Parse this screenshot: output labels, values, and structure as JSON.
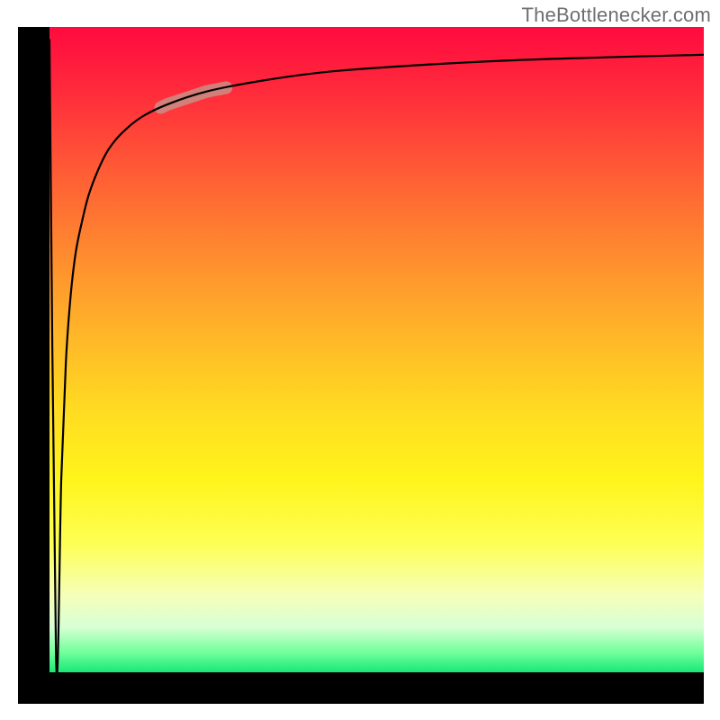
{
  "watermark": "TheBottlenecker.com",
  "chart_data": {
    "type": "line",
    "title": "",
    "xlabel": "",
    "ylabel": "",
    "xlim": [
      0,
      100
    ],
    "ylim": [
      0,
      100
    ],
    "grid": false,
    "background_gradient": {
      "direction": "vertical",
      "stops": [
        {
          "pos": 0.0,
          "color": "#ff0a3f"
        },
        {
          "pos": 0.35,
          "color": "#ff8a2f"
        },
        {
          "pos": 0.6,
          "color": "#ffdd21"
        },
        {
          "pos": 0.88,
          "color": "#f5ffb8"
        },
        {
          "pos": 1.0,
          "color": "#18e877"
        }
      ]
    },
    "series": [
      {
        "name": "bottleneck-curve",
        "type": "line",
        "color": "#000000",
        "x": [
          0,
          1.0,
          1.8,
          2.5,
          3.2,
          4.0,
          5.0,
          6.0,
          7.5,
          9.0,
          11,
          14,
          18,
          24,
          32,
          42,
          55,
          70,
          85,
          100
        ],
        "y": [
          98,
          2,
          30,
          48,
          58,
          65,
          70,
          74,
          78,
          81,
          83.5,
          86,
          88,
          90,
          91.6,
          93,
          94,
          94.8,
          95.3,
          95.7
        ]
      }
    ],
    "annotations": [
      {
        "type": "highlight-segment",
        "series": "bottleneck-curve",
        "x_range": [
          17,
          27
        ],
        "color": "#c98e86",
        "stroke_width_px": 14
      }
    ]
  },
  "geometry": {
    "inner_w": 727,
    "inner_h": 717
  }
}
